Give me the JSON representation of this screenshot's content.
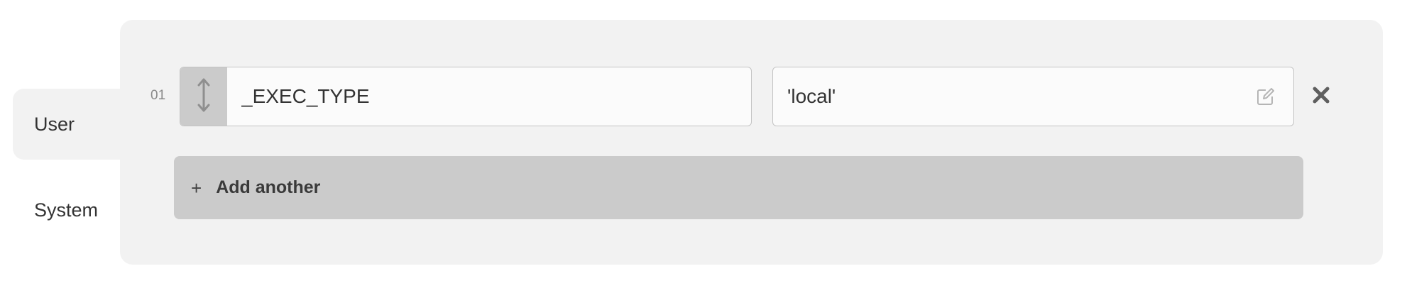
{
  "tabs": [
    {
      "label": "User",
      "active": true
    },
    {
      "label": "System",
      "active": false
    }
  ],
  "variables": {
    "rows": [
      {
        "index": "01",
        "key": "_EXEC_TYPE",
        "value": "'local'"
      }
    ],
    "add_label": "Add another",
    "add_icon": "+"
  },
  "icons": {
    "drag": "drag-handle-vertical-arrows-icon",
    "edit": "edit-pencil-icon",
    "remove": "close-x-icon"
  },
  "colors": {
    "panel_bg": "#f2f2f2",
    "handle_bg": "#cbcbcb",
    "add_button_bg": "#cbcbcb",
    "text": "#333333"
  }
}
